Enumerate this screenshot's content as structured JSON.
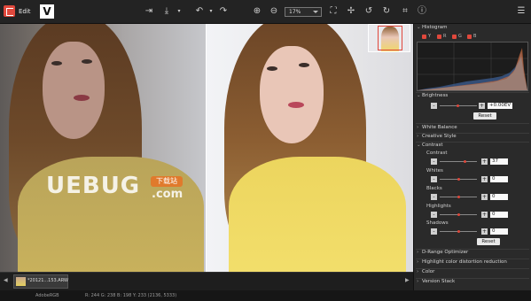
{
  "toolbar": {
    "edit_label": "Edit",
    "app_logo_letter": "V",
    "zoom_value": "17%"
  },
  "viewer": {
    "watermark": {
      "main": "UEBUG",
      "tag": "下载站",
      "com": ".com"
    }
  },
  "filmstrip": {
    "file_name": "*20121...153.ARW",
    "left_arrow": "◀",
    "right_arrow": "▶"
  },
  "status": {
    "profile": "AdobeRGB",
    "readout": "R: 244  G: 238  B: 198  Y: 233    (2136, 5333)"
  },
  "panel": {
    "histogram": {
      "label": "Histogram",
      "channels": [
        "Y",
        "R",
        "G",
        "B"
      ]
    },
    "brightness": {
      "label": "Brightness",
      "value": "+0.00EV",
      "reset": "Reset"
    },
    "white_balance": "White Balance",
    "creative_style": "Creative Style",
    "contrast": {
      "label": "Contrast",
      "rows": [
        {
          "label": "Contrast",
          "value": "37"
        },
        {
          "label": "Whites",
          "value": "0"
        },
        {
          "label": "Blacks",
          "value": "0"
        },
        {
          "label": "Highlights",
          "value": "0"
        },
        {
          "label": "Shadows",
          "value": "0"
        }
      ],
      "reset": "Reset"
    },
    "sections": [
      "D-Range Optimizer",
      "Highlight color distortion reduction",
      "Color",
      "Version Stack"
    ]
  },
  "colors": {
    "accent": "#e0483c",
    "panel_bg": "#2a2a2a",
    "toolbar_bg": "#232323"
  }
}
